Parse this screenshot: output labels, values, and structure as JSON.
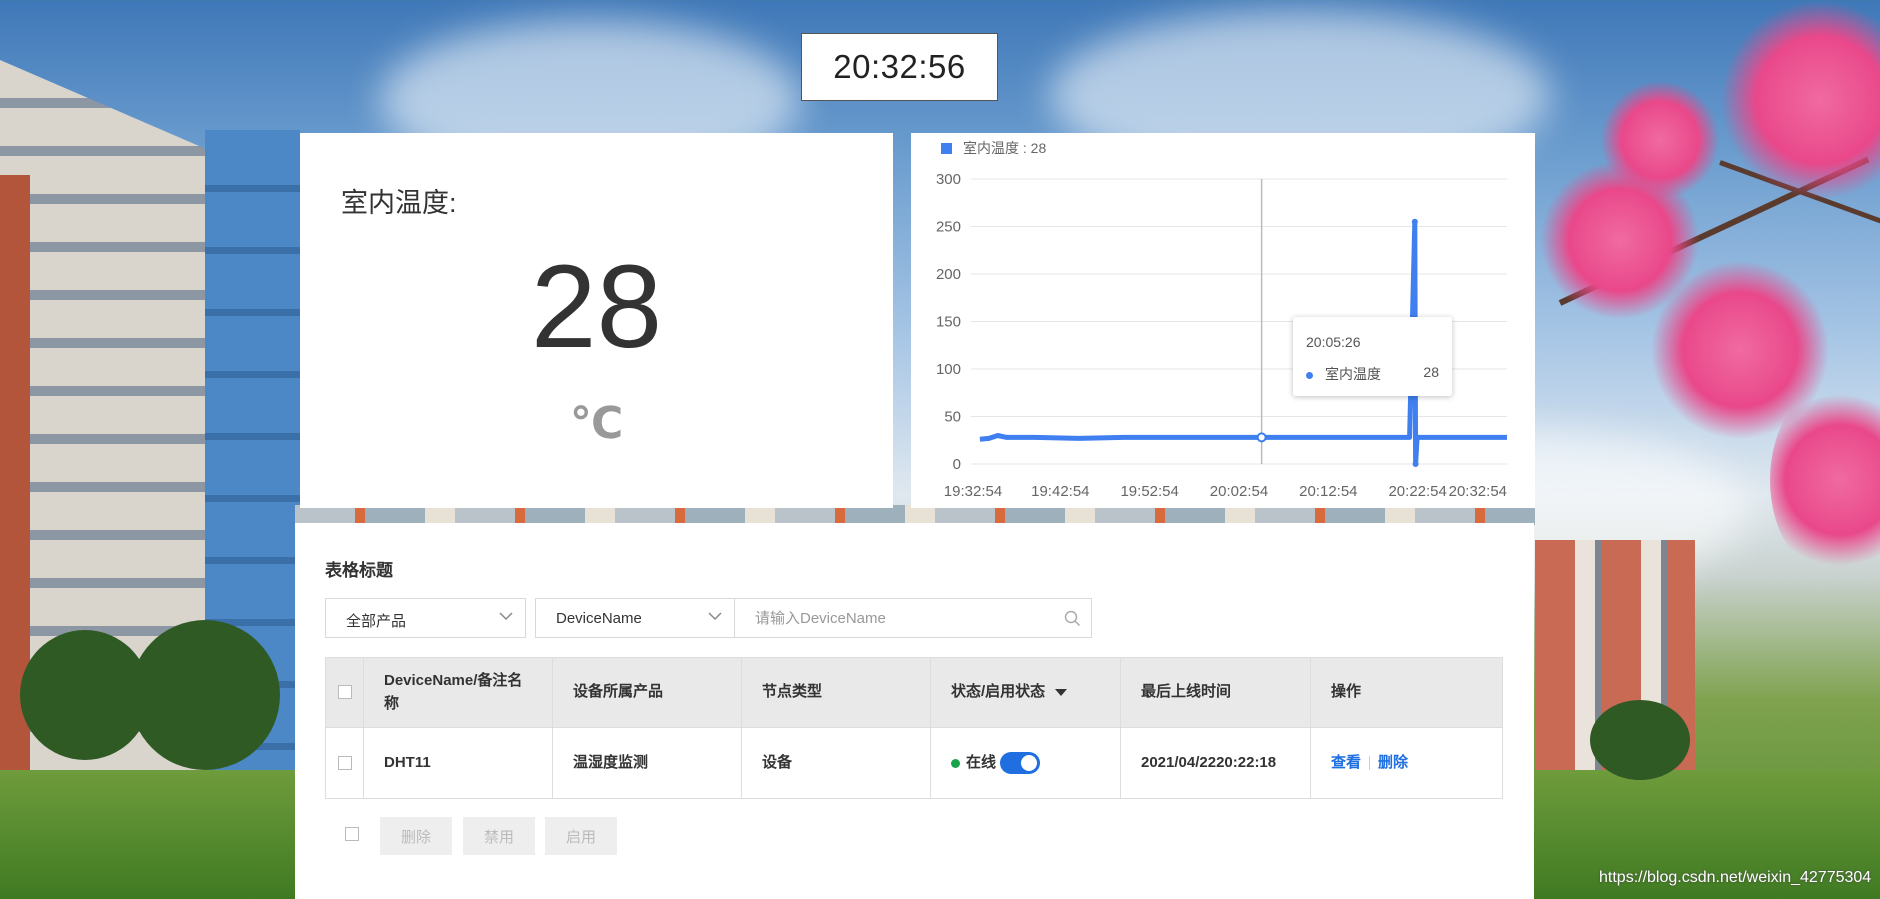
{
  "clock": {
    "time": "20:32:56"
  },
  "temperature_card": {
    "title": "室内温度:",
    "value": "28",
    "unit": "℃"
  },
  "chart_data": {
    "type": "line",
    "legend": [
      {
        "name": "室内温度 : 28",
        "color": "#3f7ff0"
      }
    ],
    "y_ticks": [
      "300",
      "250",
      "200",
      "150",
      "100",
      "50",
      "0"
    ],
    "x_ticks": [
      "19:32:54",
      "19:42:54",
      "19:52:54",
      "20:02:54",
      "20:12:54",
      "20:22:54",
      "20:32:54"
    ],
    "ylim": [
      0,
      300
    ],
    "xlim": [
      "19:32:54",
      "20:32:54"
    ],
    "grid": true,
    "series": [
      {
        "name": "室内温度",
        "color": "#3f7ff0",
        "points": [
          [
            "19:33:54",
            26
          ],
          [
            "19:34:54",
            27
          ],
          [
            "19:35:54",
            30
          ],
          [
            "19:36:54",
            28
          ],
          [
            "19:40:00",
            28
          ],
          [
            "19:45:00",
            27
          ],
          [
            "19:50:00",
            28
          ],
          [
            "19:55:00",
            28
          ],
          [
            "20:00:00",
            28
          ],
          [
            "20:05:26",
            28
          ],
          [
            "20:10:00",
            28
          ],
          [
            "20:15:00",
            28
          ],
          [
            "20:22:00",
            28
          ],
          [
            "20:22:35",
            255
          ],
          [
            "20:22:40",
            0
          ],
          [
            "20:22:50",
            28
          ],
          [
            "20:27:00",
            28
          ],
          [
            "20:32:54",
            28
          ]
        ]
      }
    ],
    "tooltip": {
      "time": "20:05:26",
      "series": "室内温度",
      "value": "28",
      "cursor_time": "20:05:26"
    }
  },
  "table_panel": {
    "title": "表格标题",
    "product_select": {
      "value": "全部产品"
    },
    "field_select": {
      "value": "DeviceName"
    },
    "search": {
      "placeholder": "请输入DeviceName",
      "value": ""
    },
    "columns": [
      "DeviceName/备注名称",
      "设备所属产品",
      "节点类型",
      "状态/启用状态",
      "最后上线时间",
      "操作"
    ],
    "rows": [
      {
        "device_name": "DHT11",
        "product": "温湿度监测",
        "node_type": "设备",
        "status": "在线",
        "status_color": "#19a34a",
        "enabled": true,
        "last_online": "2021/04/2220:22:18",
        "actions": [
          "查看",
          "删除"
        ]
      }
    ],
    "bulk_buttons": [
      "删除",
      "禁用",
      "启用"
    ]
  },
  "watermark": "https://blog.csdn.net/weixin_42775304",
  "colors": {
    "accent": "#1f6fe0",
    "chart_line": "#3f7ff0",
    "online": "#19a34a"
  }
}
